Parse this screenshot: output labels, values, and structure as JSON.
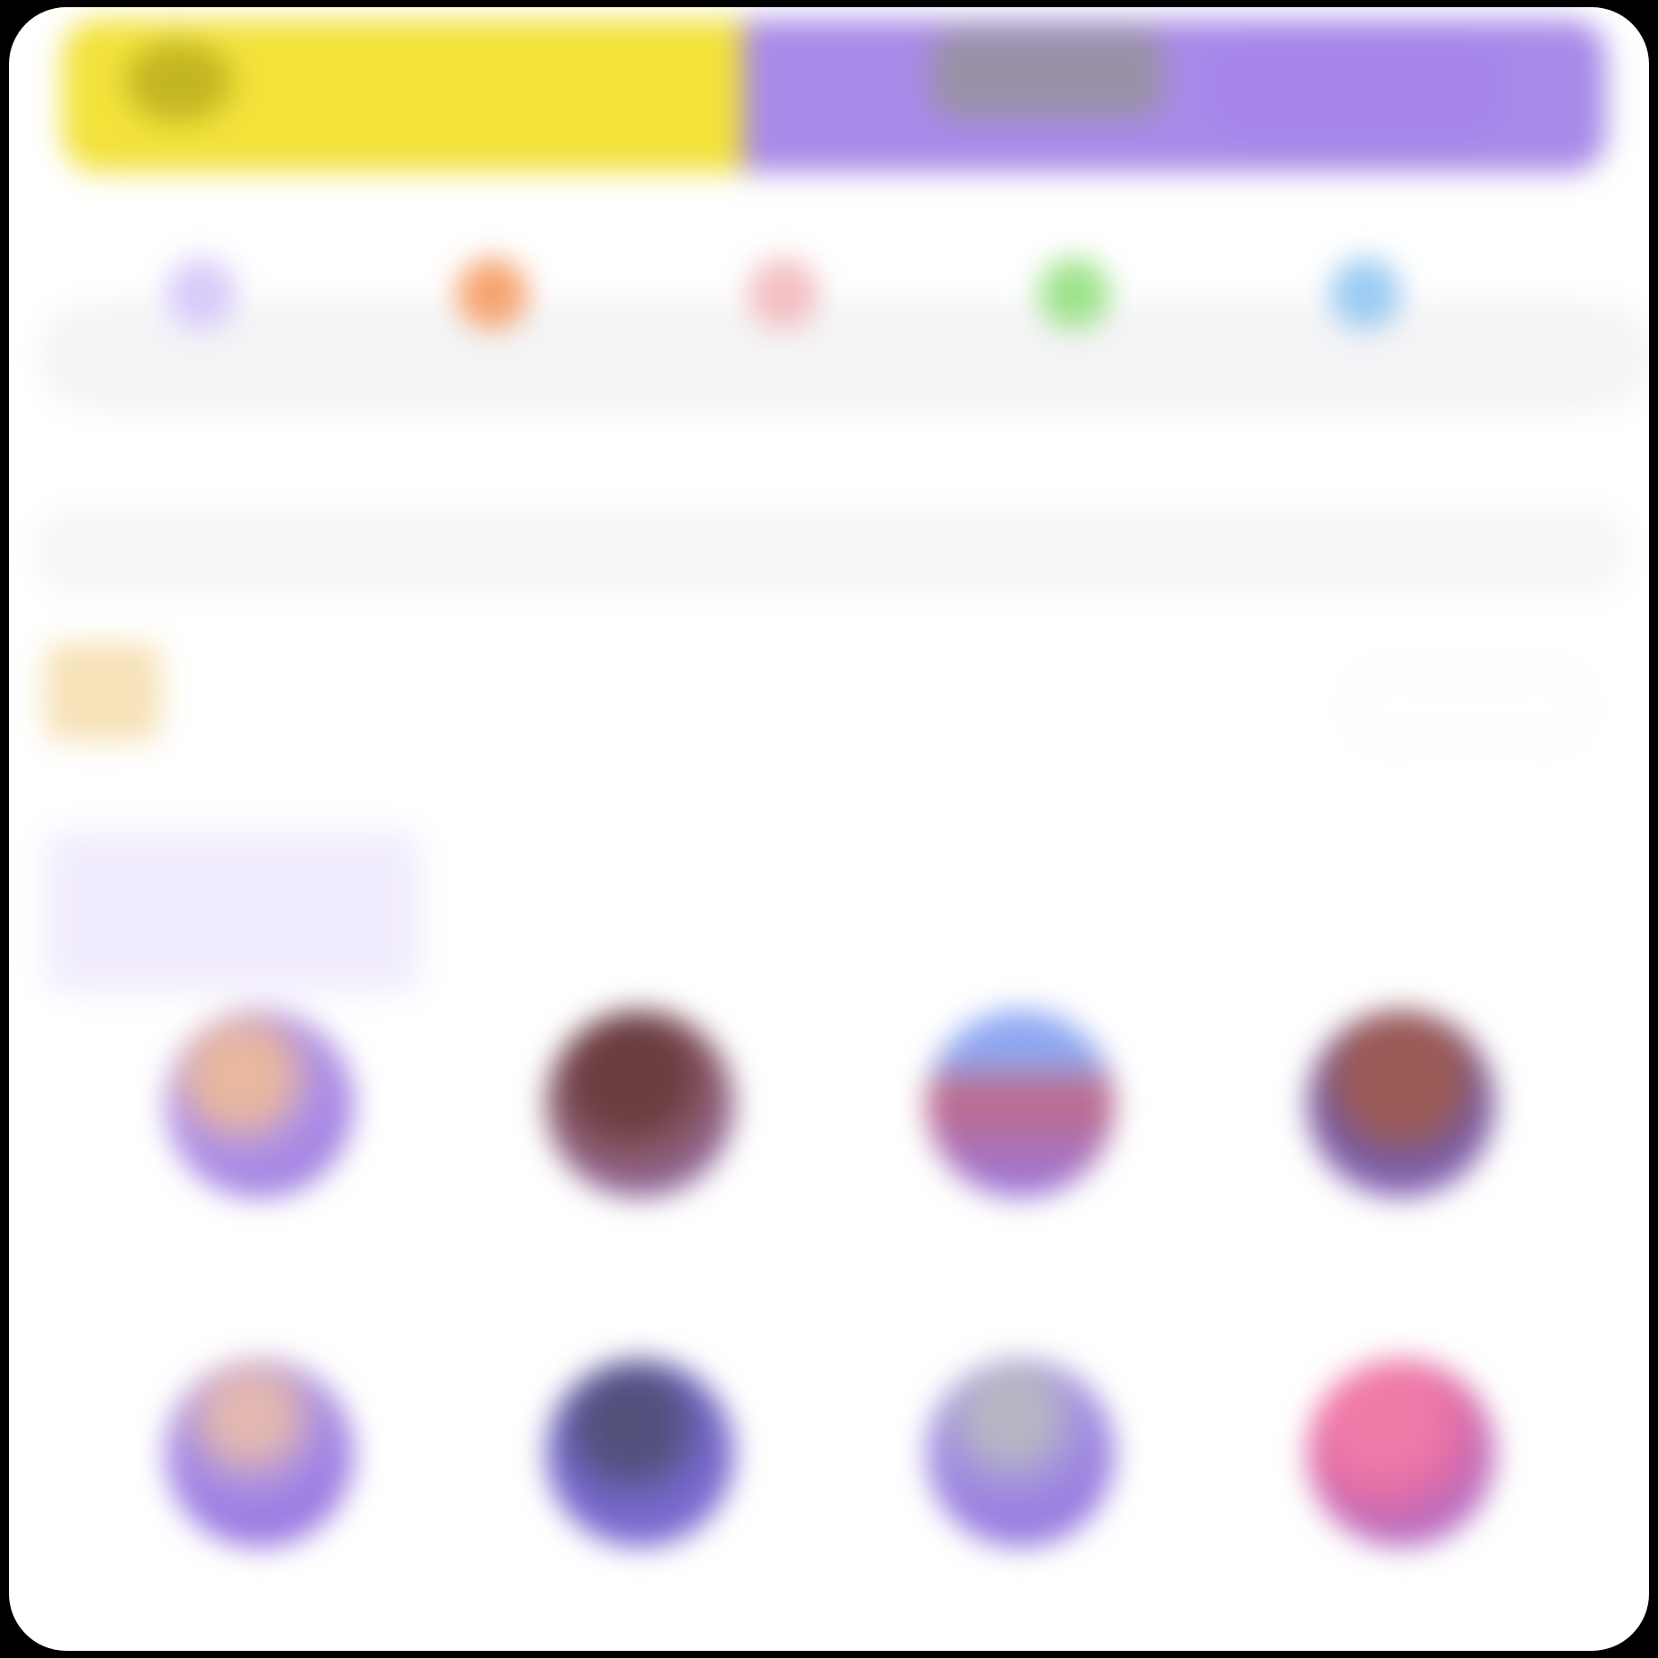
{
  "banner": {
    "text": "",
    "cta_primary": "",
    "cta_secondary": ""
  },
  "categories": [
    {
      "label": "",
      "color": "#d8cbfa",
      "icon": "category-icon"
    },
    {
      "label": "",
      "color": "#f6a470",
      "icon": "category-icon"
    },
    {
      "label": "",
      "color": "#f3bfc2",
      "icon": "category-icon"
    },
    {
      "label": "",
      "color": "#9ee38c",
      "icon": "category-icon"
    },
    {
      "label": "",
      "color": "#9ccbf2",
      "icon": "category-icon"
    },
    {
      "label": "",
      "color": "#e8e8e8",
      "icon": "category-icon"
    }
  ],
  "search": {
    "placeholder": ""
  },
  "store": {
    "name": "",
    "meta": "",
    "follow_label": ""
  },
  "tabs": [
    {
      "label": ""
    },
    {
      "label": ""
    },
    {
      "label": ""
    }
  ],
  "products": [
    {
      "title": "",
      "color": "#b191e5"
    },
    {
      "title": "",
      "color": "#8a5a6a"
    },
    {
      "title": "",
      "color": "#a17ed8"
    },
    {
      "title": "",
      "color": "#9a5a56"
    },
    {
      "title": "",
      "color": "#a58ae4"
    },
    {
      "title": "",
      "color": "#7468c9"
    },
    {
      "title": "",
      "color": "#a08ce0"
    },
    {
      "title": "",
      "color": "#df6ea7"
    }
  ],
  "colors": {
    "accent": "#a78ae8",
    "banner_yellow": "#f2e23a",
    "bg": "#ffffff"
  }
}
